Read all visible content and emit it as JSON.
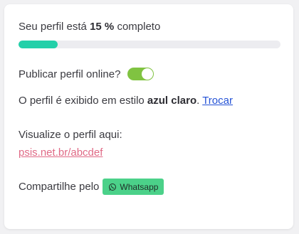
{
  "profile": {
    "completion_prefix": "Seu perfil está",
    "completion_value": "15 %",
    "completion_suffix": "completo",
    "completion_fraction": 0.15
  },
  "publish": {
    "label": "Publicar perfil online?",
    "enabled": true
  },
  "style": {
    "prefix": "O perfil é exibido em estilo",
    "value": "azul claro",
    "suffix": ".",
    "change_label": "Trocar"
  },
  "visual": {
    "label": "Visualize o perfil aqui:",
    "link": "psis.net.br/abcdef"
  },
  "share": {
    "label": "Compartilhe pelo",
    "button_label": "Whatsapp",
    "icon": "whatsapp-icon"
  },
  "colors": {
    "progress": "#23d0a9",
    "toggle_on": "#80c341",
    "link": "#2452d6",
    "profile_link": "#e06a86",
    "whatsapp": "#4bd189"
  }
}
